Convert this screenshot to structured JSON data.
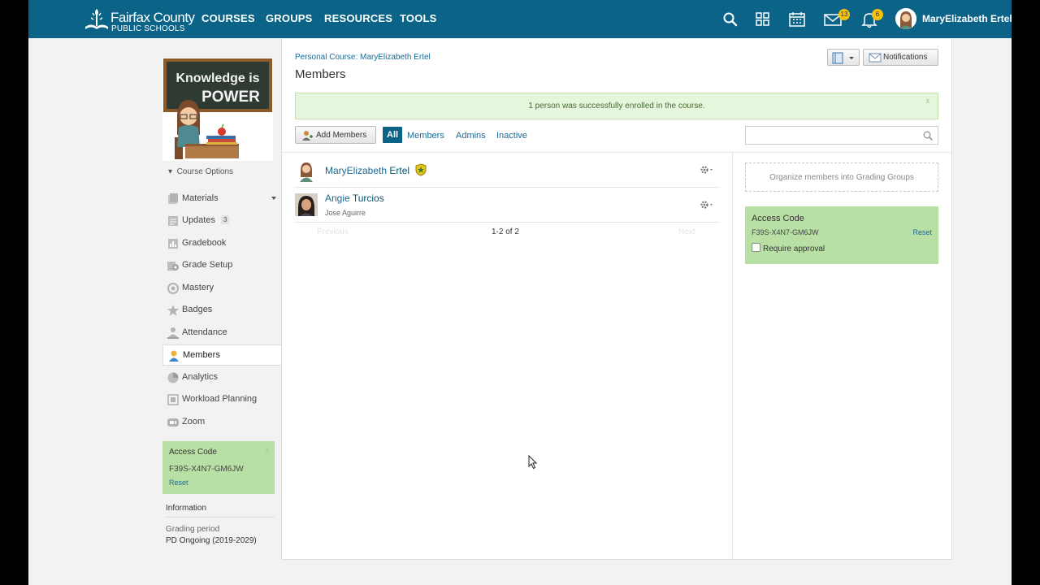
{
  "header": {
    "logo_line1": "Fairfax County",
    "logo_line2": "PUBLIC SCHOOLS",
    "nav": [
      "COURSES",
      "GROUPS",
      "RESOURCES",
      "TOOLS"
    ],
    "messages_count": "13",
    "notifications_count": "6",
    "user_name": "MaryElizabeth Ertel",
    "icons": [
      "search-icon",
      "apps-grid-icon",
      "calendar-icon",
      "mail-icon",
      "bell-icon"
    ]
  },
  "course_picture": {
    "line1": "Knowledge is",
    "line2": "POWER"
  },
  "sidebar": {
    "course_options": "Course Options",
    "items": [
      {
        "label": "Materials",
        "icon": "materials-icon"
      },
      {
        "label": "Updates",
        "icon": "updates-icon",
        "count": "3"
      },
      {
        "label": "Gradebook",
        "icon": "gradebook-icon"
      },
      {
        "label": "Grade Setup",
        "icon": "grade-setup-icon"
      },
      {
        "label": "Mastery",
        "icon": "mastery-icon"
      },
      {
        "label": "Badges",
        "icon": "badges-icon"
      },
      {
        "label": "Attendance",
        "icon": "attendance-icon"
      },
      {
        "label": "Members",
        "icon": "members-icon",
        "active": true
      },
      {
        "label": "Analytics",
        "icon": "analytics-icon"
      },
      {
        "label": "Workload Planning",
        "icon": "workload-icon"
      },
      {
        "label": "Zoom",
        "icon": "zoom-icon"
      }
    ],
    "access_code": {
      "title": "Access Code",
      "code": "F39S-X4N7-GM6JW",
      "reset": "Reset",
      "close": "×"
    },
    "information": {
      "title": "Information",
      "grading_period_label": "Grading period",
      "grading_period_value": "PD Ongoing (2019-2029)"
    }
  },
  "main": {
    "breadcrumb": "Personal Course: MaryElizabeth Ertel",
    "title": "Members",
    "notifications_label": "Notifications",
    "alert": "1 person was successfully enrolled in the course.",
    "alert_close": "x",
    "add_members": "Add Members",
    "filters": [
      "All",
      "Members",
      "Admins",
      "Inactive"
    ],
    "search_placeholder": "",
    "members": [
      {
        "first": "MaryElizabeth",
        "last": "Ertel",
        "subtitle": "",
        "admin": true
      },
      {
        "first": "Angie",
        "last": "Turcios",
        "subtitle": "Jose Aguirre",
        "admin": false
      }
    ],
    "pager": {
      "previous": "Previous",
      "summary": "1-2 of 2",
      "next": "Next"
    },
    "grading_groups": "Organize members into Grading Groups",
    "access_code": {
      "title": "Access Code",
      "code": "F39S-X4N7-GM6JW",
      "reset": "Reset",
      "require_approval": "Require approval"
    }
  },
  "colors": {
    "header": "#0b6487",
    "link": "#1a6b95",
    "access_green": "#b8e0a4",
    "alert_bg": "#e6f6dc",
    "badge": "#f4c20d"
  }
}
